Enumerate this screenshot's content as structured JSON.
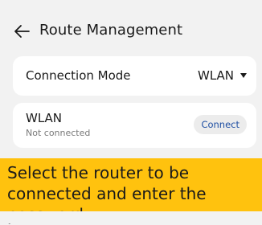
{
  "header": {
    "title": "Route Management",
    "back_icon": "arrow-left-icon"
  },
  "connection_mode": {
    "label": "Connection Mode",
    "selected": "WLAN",
    "dropdown_icon": "caret-down-icon"
  },
  "wlan": {
    "name": "WLAN",
    "status": "Not connected",
    "connect_label": "Connect"
  },
  "instruction": {
    "text": "Select the router to be connected and enter the password."
  },
  "colors": {
    "background": "#f2f2f2",
    "card": "#ffffff",
    "accent_text": "#1f4fa3",
    "banner": "#ffc20e"
  }
}
